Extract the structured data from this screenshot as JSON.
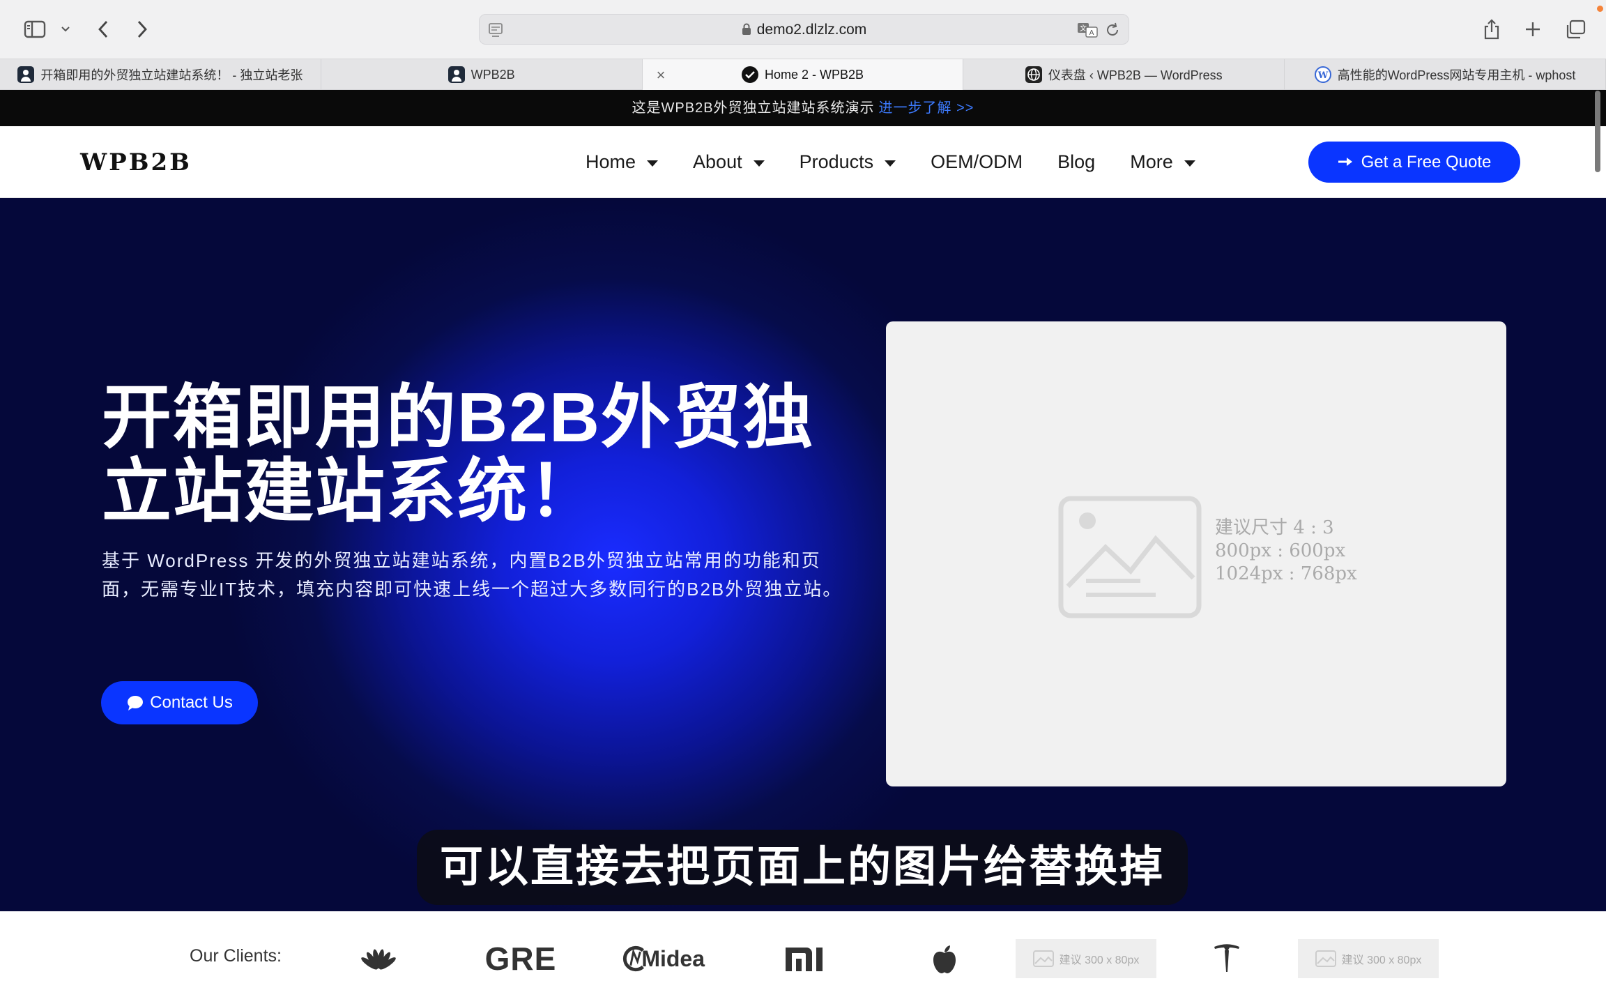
{
  "browser": {
    "url": "demo2.dlzlz.com",
    "tabs": [
      {
        "label": "开箱即用的外贸独立站建站系统！ - 独立站老张",
        "icon": "avatar-icon",
        "active": false
      },
      {
        "label": "WPB2B",
        "icon": "avatar-icon",
        "active": false
      },
      {
        "label": "Home 2 - WPB2B",
        "icon": "check-circle-icon",
        "active": true
      },
      {
        "label": "仪表盘 ‹ WPB2B — WordPress",
        "icon": "globe-icon",
        "active": false
      },
      {
        "label": "高性能的WordPress网站专用主机 - wphost",
        "icon": "wordpress-icon",
        "active": false
      }
    ],
    "close_symbol": "×"
  },
  "notice": {
    "text": "这是WPB2B外贸独立站建站系统演示",
    "link": "进一步了解 >>"
  },
  "header": {
    "logo": "WPB2B",
    "nav": [
      {
        "label": "Home",
        "dropdown": true
      },
      {
        "label": "About",
        "dropdown": true
      },
      {
        "label": "Products",
        "dropdown": true
      },
      {
        "label": "OEM/ODM",
        "dropdown": false
      },
      {
        "label": "Blog",
        "dropdown": false
      },
      {
        "label": "More",
        "dropdown": true
      }
    ],
    "cta": "Get a Free Quote"
  },
  "hero": {
    "title_line1": "开箱即用的B2B外贸独",
    "title_line2": "立站建站系统！",
    "description": "基于 WordPress 开发的外贸独立站建站系统，内置B2B外贸独立站常用的功能和页面，无需专业IT技术，填充内容即可快速上线一个超过大多数同行的B2B外贸独立站。",
    "contact_button": "Contact Us",
    "placeholder": {
      "line1": "建议尺寸 4 : 3",
      "line2": "800px : 600px",
      "line3": "1024px : 768px"
    }
  },
  "video_subtitle": "可以直接去把页面上的图片给替换掉",
  "clients": {
    "label": "Our Clients:",
    "logos": [
      "huawei-logo",
      "GRE",
      "Midea",
      "mi-logo",
      "apple-logo",
      "placeholder",
      "tesla-logo",
      "placeholder"
    ],
    "gre_text": "GRE",
    "midea_text": "Midea",
    "placeholder_text": "建议 300 x 80px"
  },
  "colors": {
    "accent": "#0a35ff",
    "notice_link": "#3d7bff",
    "hero_dark": "#05083a"
  }
}
